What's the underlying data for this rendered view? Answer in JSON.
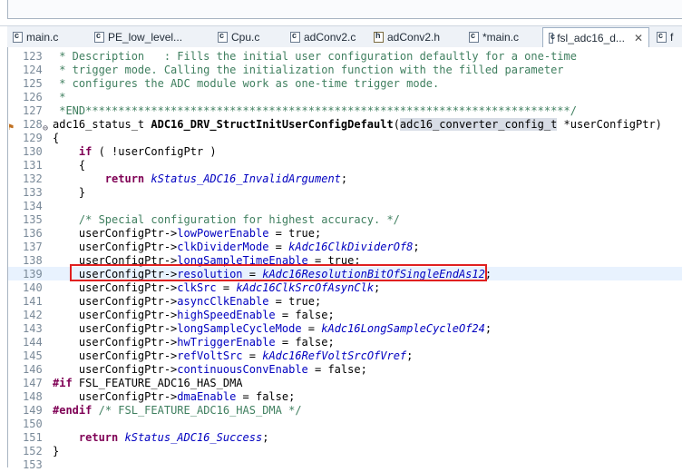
{
  "tabs": [
    {
      "label": "main.c",
      "icon": "c-file-icon",
      "kind": "c"
    },
    {
      "label": "PE_low_level...",
      "icon": "c-file-icon",
      "kind": "c"
    },
    {
      "label": "Cpu.c",
      "icon": "c-file-icon",
      "kind": "c"
    },
    {
      "label": "adConv2.c",
      "icon": "c-file-icon",
      "kind": "c"
    },
    {
      "label": "adConv2.h",
      "icon": "h-file-icon",
      "kind": "h"
    },
    {
      "label": "*main.c",
      "icon": "c-file-icon",
      "kind": "c"
    },
    {
      "label": "fsl_adc16_d...",
      "icon": "c-file-icon",
      "kind": "c",
      "active": true,
      "close": "✕"
    },
    {
      "label": "f",
      "icon": "c-file-icon",
      "kind": "c"
    }
  ],
  "editor": {
    "lines": [
      {
        "n": "123",
        "t": " * Description   : Fills the initial user configuration defaultly for a one-time",
        "cls": "comment"
      },
      {
        "n": "124",
        "t": " * trigger mode. Calling the initialization function with the filled parameter",
        "cls": "comment"
      },
      {
        "n": "125",
        "t": " * configures the ADC module work as one-time trigger mode.",
        "cls": "comment"
      },
      {
        "n": "126",
        "t": " *",
        "cls": "comment"
      },
      {
        "n": "127",
        "t": " *END**************************************************************************/",
        "cls": "comment"
      },
      {
        "n": "128",
        "t": "adc16_status_t ADC16_DRV_StructInitUserConfigDefault(adc16_converter_config_t *userConfigPtr)",
        "cls": "sig"
      },
      {
        "n": "129",
        "t": "{",
        "cls": ""
      },
      {
        "n": "130",
        "t": "    if ( !userConfigPtr )",
        "cls": "ifline"
      },
      {
        "n": "131",
        "t": "    {",
        "cls": ""
      },
      {
        "n": "132",
        "t": "        return kStatus_ADC16_InvalidArgument;",
        "cls": "ret1"
      },
      {
        "n": "133",
        "t": "    }",
        "cls": ""
      },
      {
        "n": "134",
        "t": "",
        "cls": ""
      },
      {
        "n": "135",
        "t": "    /* Special configuration for highest accuracy. */",
        "cls": "comment"
      },
      {
        "n": "136",
        "t": "    userConfigPtr->lowPowerEnable = true;",
        "cls": "assign"
      },
      {
        "n": "137",
        "t": "    userConfigPtr->clkDividerMode = kAdc16ClkDividerOf8;",
        "cls": "assign"
      },
      {
        "n": "138",
        "t": "    userConfigPtr->longSampleTimeEnable = true;",
        "cls": "assign"
      },
      {
        "n": "139",
        "t": "    userConfigPtr->resolution = kAdc16ResolutionBitOfSingleEndAs12;",
        "cls": "assign"
      },
      {
        "n": "140",
        "t": "    userConfigPtr->clkSrc = kAdc16ClkSrcOfAsynClk;",
        "cls": "assign"
      },
      {
        "n": "141",
        "t": "    userConfigPtr->asyncClkEnable = true;",
        "cls": "assign"
      },
      {
        "n": "142",
        "t": "    userConfigPtr->highSpeedEnable = false;",
        "cls": "assign"
      },
      {
        "n": "143",
        "t": "    userConfigPtr->longSampleCycleMode = kAdc16LongSampleCycleOf24;",
        "cls": "assign"
      },
      {
        "n": "144",
        "t": "    userConfigPtr->hwTriggerEnable = false;",
        "cls": "assign"
      },
      {
        "n": "145",
        "t": "    userConfigPtr->refVoltSrc = kAdc16RefVoltSrcOfVref;",
        "cls": "assign"
      },
      {
        "n": "146",
        "t": "    userConfigPtr->continuousConvEnable = false;",
        "cls": "assign"
      },
      {
        "n": "147",
        "t": "#if FSL_FEATURE_ADC16_HAS_DMA",
        "cls": "pp"
      },
      {
        "n": "148",
        "t": "    userConfigPtr->dmaEnable = false;",
        "cls": "assign"
      },
      {
        "n": "149",
        "t": "#endif /* FSL_FEATURE_ADC16_HAS_DMA */",
        "cls": "ppend"
      },
      {
        "n": "150",
        "t": "",
        "cls": ""
      },
      {
        "n": "151",
        "t": "    return kStatus_ADC16_Success;",
        "cls": "ret2"
      },
      {
        "n": "152",
        "t": "}",
        "cls": ""
      },
      {
        "n": "153",
        "t": "",
        "cls": ""
      }
    ]
  },
  "colors": {
    "comment": "#3f7f5f",
    "keyword": "#7f0055",
    "field": "#0000c0",
    "highlight_box": "#e02020"
  }
}
